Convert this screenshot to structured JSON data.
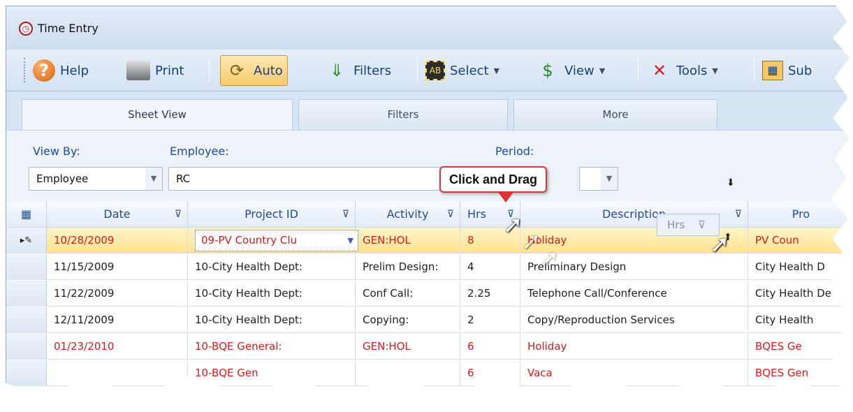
{
  "window": {
    "title": "Time Entry"
  },
  "toolbar": {
    "help_label": "Help",
    "print_label": "Print",
    "auto_label": "Auto",
    "filters_label": "Filters",
    "select_label": "Select",
    "view_label": "View",
    "tools_label": "Tools",
    "sub_label": "Sub"
  },
  "tabs": [
    {
      "label": "Sheet View"
    },
    {
      "label": "Filters"
    },
    {
      "label": "More"
    }
  ],
  "filters": {
    "view_by_label": "View By:",
    "view_by_value": "Employee",
    "employee_label": "Employee:",
    "employee_value": "RC",
    "period_label": "Period:"
  },
  "callout": {
    "text": "Click and Drag"
  },
  "drag_ghost": {
    "label": "Hrs"
  },
  "grid": {
    "columns": [
      "Date",
      "Project ID",
      "Activity",
      "Hrs",
      "Description",
      "Pro"
    ],
    "rows": [
      {
        "date": "10/28/2009",
        "project": "09-PV Country Clu",
        "activity": "GEN:HOL",
        "hrs": "8",
        "description": "Holiday",
        "pro": "PV Coun",
        "highlight": "red",
        "selected": true
      },
      {
        "date": "11/15/2009",
        "project": "10-City Health Dept:",
        "activity": "Prelim Design:",
        "hrs": "4",
        "description": "Preliminary Design",
        "pro": "City Health D",
        "highlight": "none",
        "selected": false
      },
      {
        "date": "11/22/2009",
        "project": "10-City Health Dept:",
        "activity": "Conf Call:",
        "hrs": "2.25",
        "description": "Telephone Call/Conference",
        "pro": "City Health De",
        "highlight": "none",
        "selected": false
      },
      {
        "date": "12/11/2009",
        "project": "10-City Health Dept:",
        "activity": "Copying:",
        "hrs": "2",
        "description": "Copy/Reproduction Services",
        "pro": "City Health",
        "highlight": "none",
        "selected": false
      },
      {
        "date": "01/23/2010",
        "project": "10-BQE General:",
        "activity": "GEN:HOL",
        "hrs": "6",
        "description": "Holiday",
        "pro": "BQES Ge",
        "highlight": "red",
        "selected": false
      },
      {
        "date": "",
        "project": "10-BQE Gen",
        "activity": "",
        "hrs": "6",
        "description": "Vaca",
        "pro": "BQES Gen",
        "highlight": "red",
        "selected": false
      }
    ]
  },
  "colors": {
    "accent": "#1f4b9a",
    "highlight_text": "#d21c1c",
    "selection": "#ffe28f"
  }
}
